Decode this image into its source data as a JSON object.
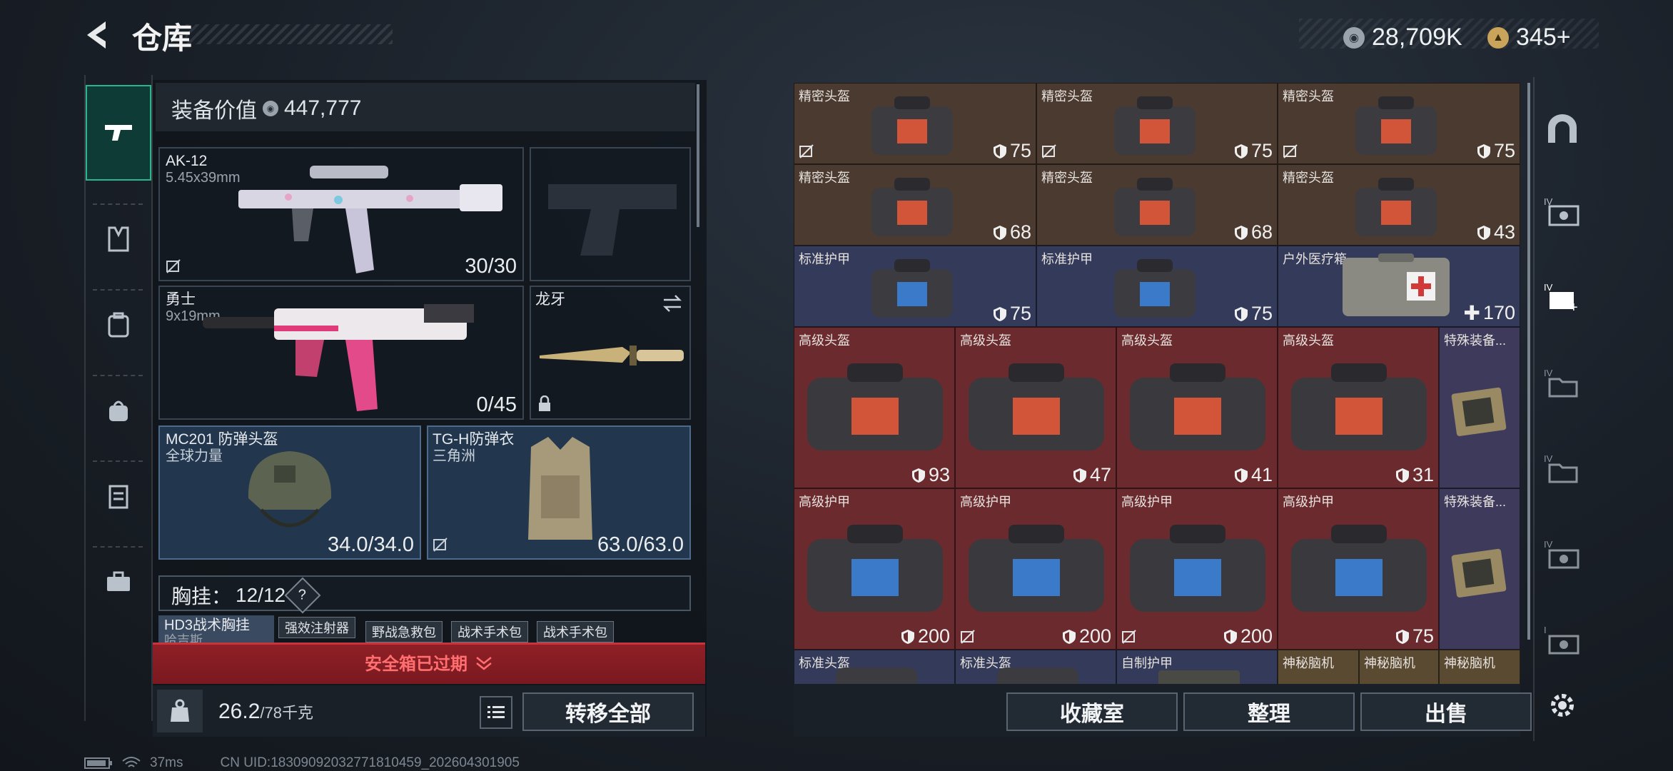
{
  "header": {
    "title": "仓库",
    "silver": "28,709K",
    "gold": "345+"
  },
  "left_nav": [
    "gun-icon",
    "vest-icon",
    "backpack-icon",
    "bag-icon",
    "clipboard-icon",
    "briefcase-icon"
  ],
  "equipment": {
    "value_label": "装备价值",
    "value": "447,777",
    "primary": {
      "name": "AK-12",
      "ammo": "5.45x39mm",
      "count": "30/30"
    },
    "secondary": {
      "name": "勇士",
      "ammo": "9x19mm",
      "count": "0/45"
    },
    "melee": {
      "name": "龙牙"
    },
    "helmet": {
      "name": "MC201 防弹头盔",
      "sub": "全球力量",
      "count": "34.0/34.0"
    },
    "armor": {
      "name": "TG-H防弹衣",
      "sub": "三角洲",
      "count": "63.0/63.0"
    },
    "chest_label": "胸挂：",
    "chest_count": "12/12",
    "chest_help": "?",
    "chest_name": "HD3战术胸挂",
    "chest_sub": "哈吉斯",
    "chips": [
      "强效注射器",
      "野战急救包",
      "战术手术包",
      "战术手术包"
    ],
    "expired": "安全箱已过期",
    "weight": "26.2",
    "weight_max": "/78千克",
    "transfer_all": "转移全部"
  },
  "grid": {
    "row1": [
      {
        "name": "精密头盔",
        "value": "75"
      },
      {
        "name": "精密头盔",
        "value": "75"
      },
      {
        "name": "精密头盔",
        "value": "75"
      }
    ],
    "row2": [
      {
        "name": "精密头盔",
        "value": "68"
      },
      {
        "name": "精密头盔",
        "value": "68"
      },
      {
        "name": "精密头盔",
        "value": "43"
      }
    ],
    "row3": [
      {
        "name": "标准护甲",
        "value": "75"
      },
      {
        "name": "标准护甲",
        "value": "75"
      },
      {
        "name": "户外医疗箱",
        "value": "170"
      }
    ],
    "row4": [
      {
        "name": "高级头盔",
        "value": "93"
      },
      {
        "name": "高级头盔",
        "value": "47"
      },
      {
        "name": "高级头盔",
        "value": "41"
      },
      {
        "name": "高级头盔",
        "value": "31"
      },
      {
        "name": "特殊装备..."
      }
    ],
    "row5": [
      {
        "name": "高级护甲",
        "value": "200"
      },
      {
        "name": "高级护甲",
        "value": "200"
      },
      {
        "name": "高级护甲",
        "value": "200"
      },
      {
        "name": "高级护甲",
        "value": "75"
      },
      {
        "name": "特殊装备..."
      }
    ],
    "row6": [
      "标准头盔",
      "标准头盔",
      "自制护甲",
      "神秘脑机",
      "神秘脑机",
      "神秘脑机"
    ]
  },
  "actions": {
    "collection": "收藏室",
    "organize": "整理",
    "sell": "出售"
  },
  "status": {
    "ping": "37ms",
    "uid": "CN UID:1830909203277181045​9_202604301905"
  },
  "colors": {
    "accent": "#2ab58e",
    "expired": "#8f1f26",
    "rare_red": "#6a2a2e",
    "epic_purple": "#343b5a",
    "brown": "#4a3a30"
  }
}
